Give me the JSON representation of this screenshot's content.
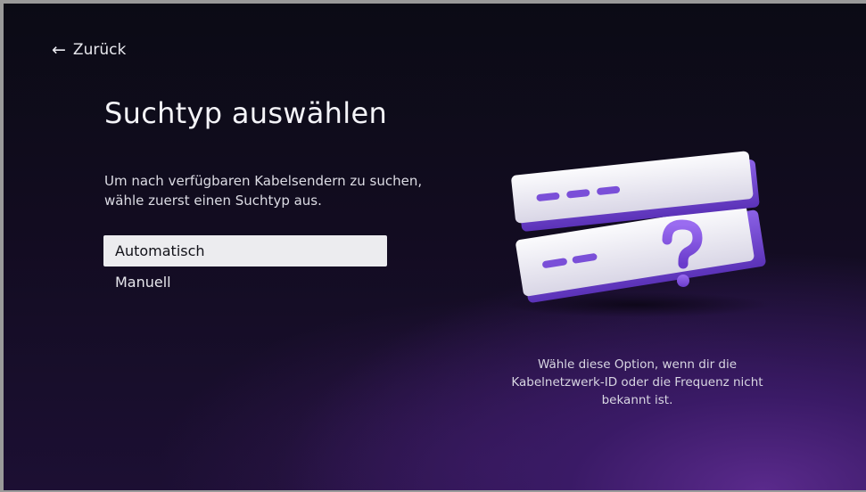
{
  "nav": {
    "back_icon": "arrow-left-icon",
    "back_label": "Zurück"
  },
  "page": {
    "title": "Suchtyp auswählen",
    "description": "Um nach verfügbaren Kabelsendern zu suchen, wähle zuerst einen Suchtyp aus."
  },
  "options": [
    {
      "label": "Automatisch",
      "selected": true
    },
    {
      "label": "Manuell",
      "selected": false
    }
  ],
  "hint": {
    "text": "Wähle diese Option, wenn dir die Kabelnetzwerk-ID oder die Frequenz nicht bekannt ist."
  },
  "illustration": {
    "icon": "search-fields-question-icon",
    "accent_color": "#7a4fd8"
  },
  "colors": {
    "background_top": "#0b0b15",
    "background_glow": "#5a2a8c",
    "selected_bg": "#ececef"
  }
}
